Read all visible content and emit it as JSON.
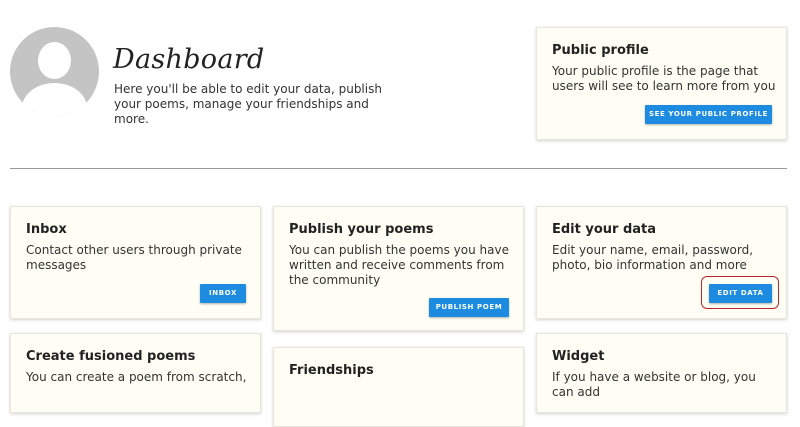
{
  "header": {
    "title": "Dashboard",
    "description": "Here you'll be able to edit your data, publish your poems, manage your friendships and more."
  },
  "public_profile": {
    "title": "Public profile",
    "text": "Your public profile is the page that users will see to learn more from you",
    "button": "SEE YOUR PUBLIC PROFILE"
  },
  "cards": {
    "inbox": {
      "title": "Inbox",
      "text": "Contact other users through private messages",
      "button": "INBOX"
    },
    "publish": {
      "title": "Publish your poems",
      "text": "You can publish the poems you have written and receive comments from the community",
      "button": "PUBLISH POEM"
    },
    "edit": {
      "title": "Edit your data",
      "text": "Edit your name, email, password, photo, bio information and more",
      "button": "EDIT DATA"
    },
    "fusioned": {
      "title": "Create fusioned poems",
      "text": "You can create a poem from scratch,"
    },
    "friendships": {
      "title": "Friendships",
      "text": ""
    },
    "widget": {
      "title": "Widget",
      "text": "If you have a website or blog, you can add"
    }
  },
  "colors": {
    "accent": "#1d8be0",
    "card_bg": "#fefef5",
    "highlight": "#c0262b"
  },
  "icons": [
    "avatar-icon"
  ]
}
